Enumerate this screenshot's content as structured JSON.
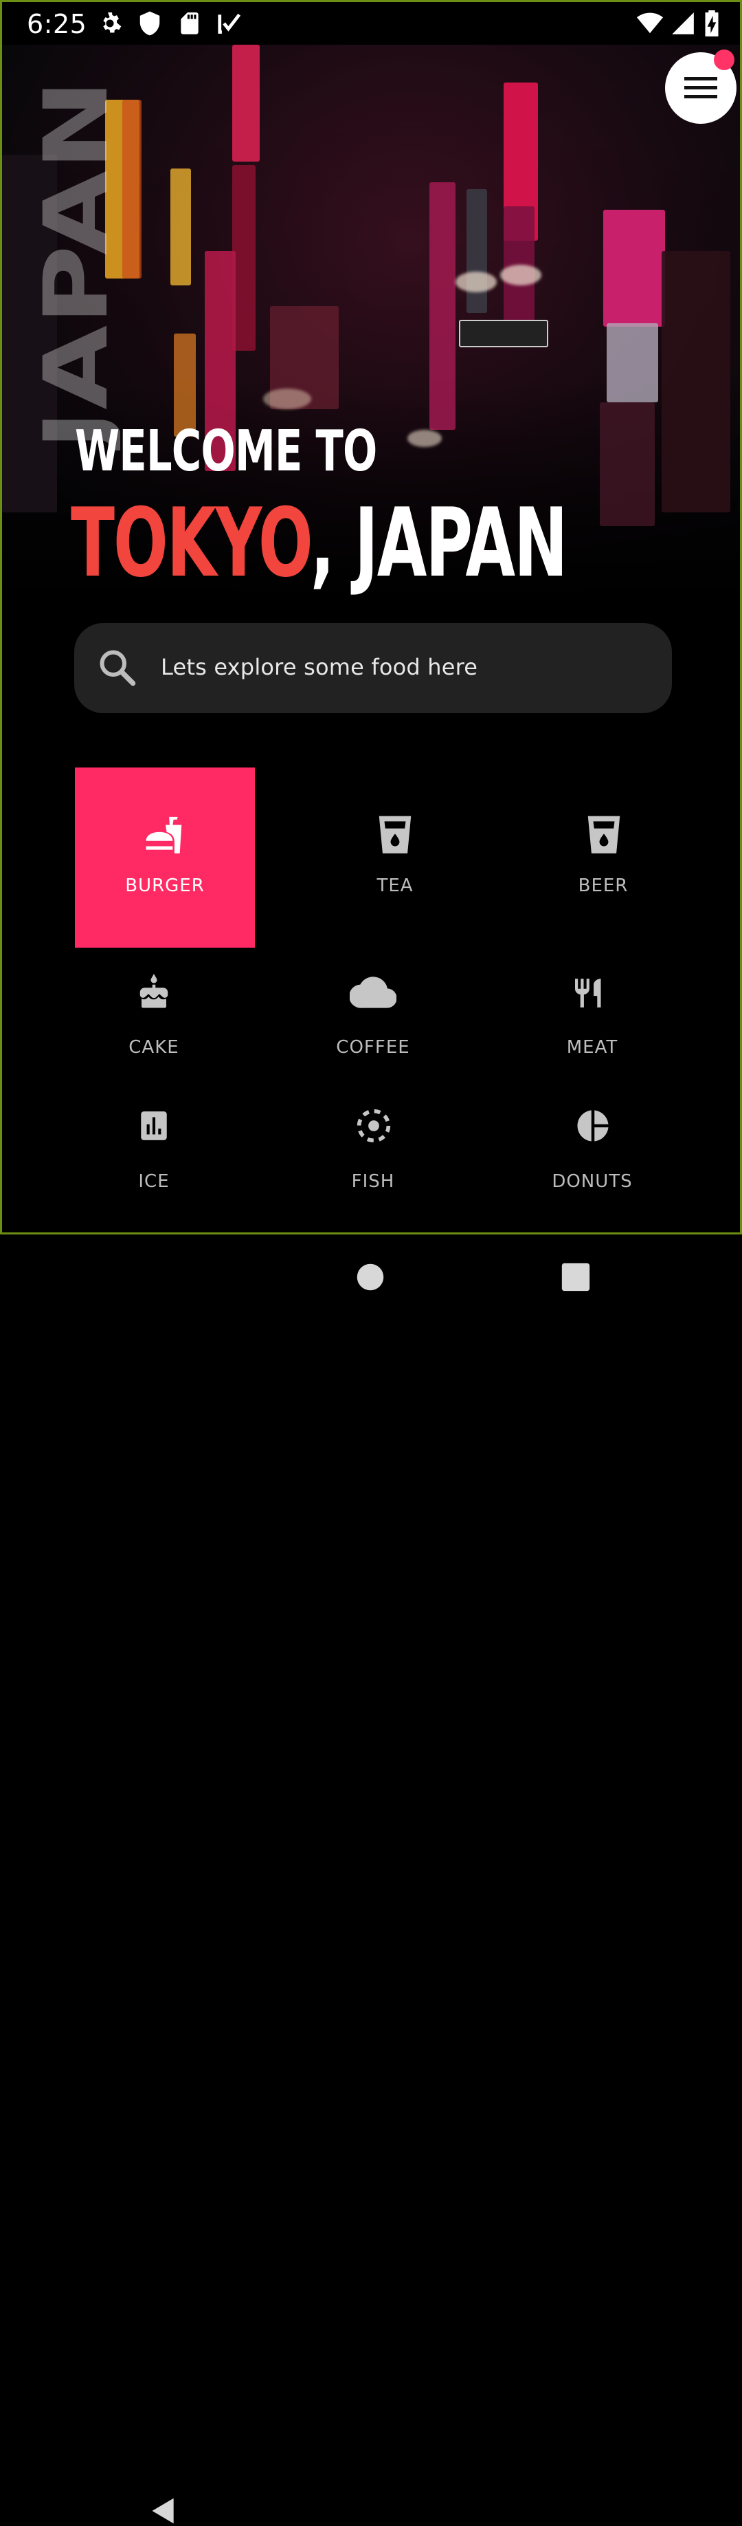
{
  "status_bar": {
    "time": "6:25",
    "left_icons": [
      "gear-icon",
      "shield-icon",
      "sd-card-icon",
      "download-check-icon"
    ],
    "right_icons": [
      "wifi-icon",
      "cell-signal-icon",
      "battery-charging-icon"
    ]
  },
  "hero": {
    "vertical_title": "JAPAN",
    "welcome": "WELCOME TO",
    "city": "TOKYO",
    "separator": ", ",
    "country": "JAPAN"
  },
  "menu": {
    "icon": "hamburger-menu-icon",
    "has_notification": true
  },
  "search": {
    "placeholder": "Lets explore some food here",
    "icon": "search-icon"
  },
  "categories": [
    {
      "label": "BURGER",
      "icon": "burger-drink-icon",
      "selected": true
    },
    {
      "label": "TEA",
      "icon": "cup-icon",
      "selected": false
    },
    {
      "label": "BEER",
      "icon": "cup-icon",
      "selected": false
    },
    {
      "label": "CAKE",
      "icon": "cake-icon",
      "selected": false
    },
    {
      "label": "COFFEE",
      "icon": "cloud-icon",
      "selected": false
    },
    {
      "label": "MEAT",
      "icon": "fork-knife-icon",
      "selected": false
    },
    {
      "label": "ICE",
      "icon": "bar-chart-icon",
      "selected": false
    },
    {
      "label": "FISH",
      "icon": "dotted-circle-icon",
      "selected": false
    },
    {
      "label": "DONUTS",
      "icon": "pie-chart-icon",
      "selected": false
    }
  ],
  "nav_bar": {
    "buttons": [
      "back-icon",
      "home-icon",
      "recents-icon"
    ]
  },
  "colors": {
    "accent": "#ff2a64",
    "city_red": "#f2453d",
    "search_bg": "#222222",
    "frame_border": "#6b8f12"
  }
}
